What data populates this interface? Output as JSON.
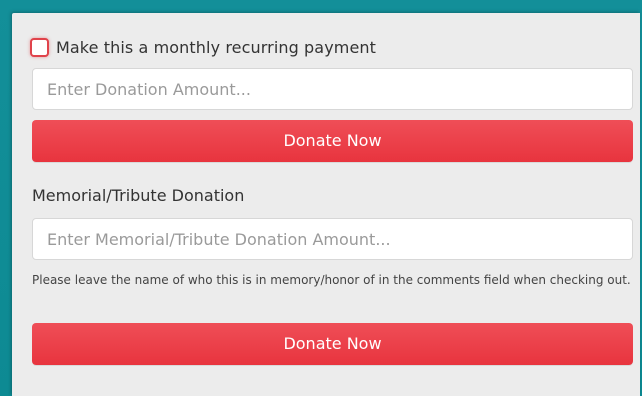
{
  "recurring": {
    "label": "Make this a monthly recurring payment",
    "checked": false
  },
  "donation": {
    "amount_value": "",
    "amount_placeholder": "Enter Donation Amount...",
    "button_label": "Donate Now"
  },
  "memorial": {
    "heading": "Memorial/Tribute Donation",
    "amount_value": "",
    "amount_placeholder": "Enter Memorial/Tribute Donation Amount...",
    "help_text": "Please leave the name of who this is in memory/honor of in the comments field when checking out.",
    "button_label": "Donate Now"
  },
  "colors": {
    "accent": "#e8343e",
    "frame": "#0f8f98",
    "panel": "#ececec"
  }
}
